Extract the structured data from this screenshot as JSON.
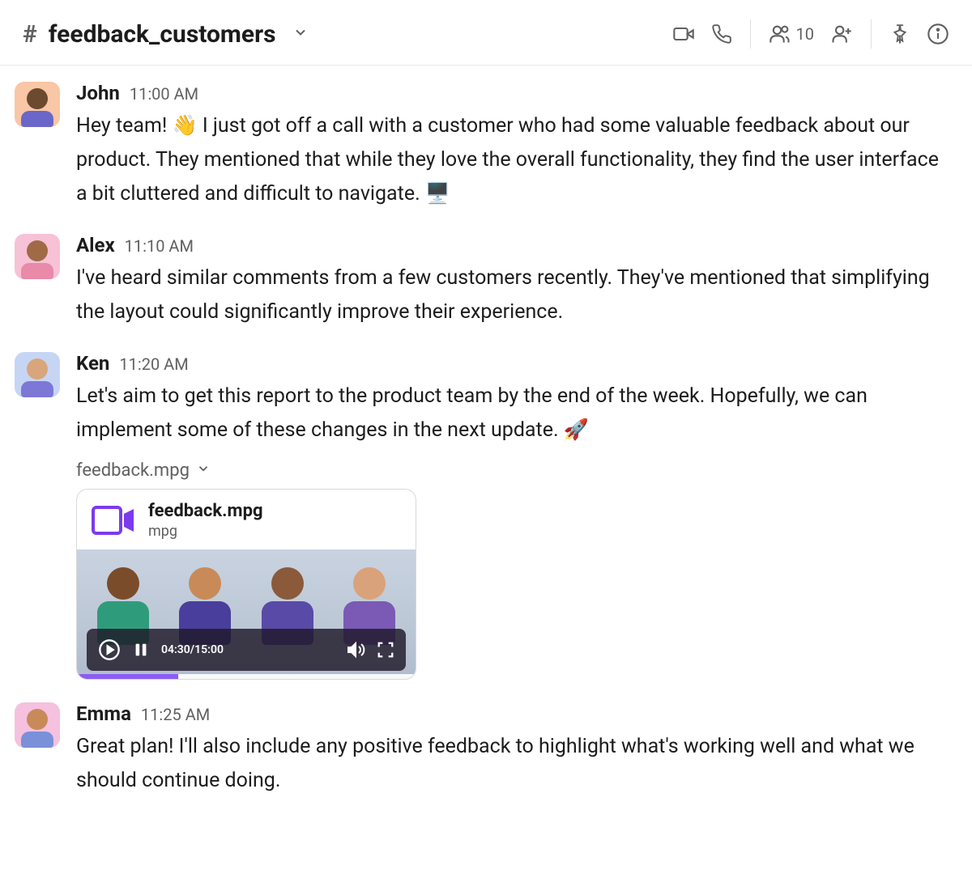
{
  "header": {
    "hash": "#",
    "channel_name": "feedback_customers",
    "member_count": "10"
  },
  "messages": [
    {
      "user": "John",
      "time": "11:00 AM",
      "avatar_class": "john",
      "text": "Hey team! 👋 I just got off a call with a customer who had some valuable feedback about our product. They mentioned that while they love the overall functionality, they find the user interface a bit cluttered and difficult to navigate. 🖥️"
    },
    {
      "user": "Alex",
      "time": "11:10 AM",
      "avatar_class": "alex",
      "text": "I've heard similar comments from a few customers recently. They've mentioned that simplifying the layout could significantly improve their experience."
    },
    {
      "user": "Ken",
      "time": "11:20 AM",
      "avatar_class": "ken",
      "text": "Let's aim to get this report to the product team by the end of the week. Hopefully, we can implement some of these changes in the next update. 🚀",
      "attachment": {
        "label": "feedback.mpg",
        "file_name": "feedback.mpg",
        "file_ext": "mpg",
        "video": {
          "elapsed": "04:30",
          "total": "15:00",
          "progress_pct": 30
        }
      }
    },
    {
      "user": "Emma",
      "time": "11:25 AM",
      "avatar_class": "emma",
      "text": "Great plan! I'll also include any positive feedback to highlight what's working well and what we should continue doing."
    }
  ]
}
